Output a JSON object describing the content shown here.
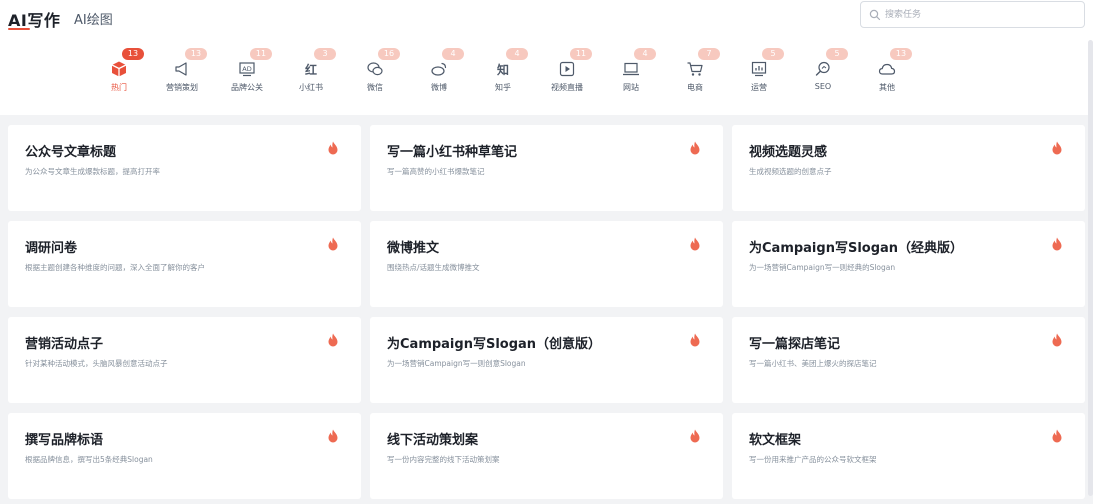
{
  "header": {
    "tabs": [
      {
        "label": "AI写作",
        "active": true
      },
      {
        "label": "AI绘图",
        "active": false
      }
    ],
    "search": {
      "placeholder": "搜索任务"
    }
  },
  "categories": [
    {
      "label": "热门",
      "count": "13",
      "icon": "cube-icon",
      "active": true
    },
    {
      "label": "营销策划",
      "count": "13",
      "icon": "megaphone-icon",
      "active": false
    },
    {
      "label": "品牌公关",
      "count": "11",
      "icon": "ad-icon",
      "active": false
    },
    {
      "label": "小红书",
      "count": "3",
      "icon": "xiaohongshu-icon",
      "active": false
    },
    {
      "label": "微信",
      "count": "16",
      "icon": "wechat-icon",
      "active": false
    },
    {
      "label": "微博",
      "count": "4",
      "icon": "weibo-icon",
      "active": false
    },
    {
      "label": "知乎",
      "count": "4",
      "icon": "zhihu-icon",
      "active": false
    },
    {
      "label": "视频直播",
      "count": "11",
      "icon": "video-play-icon",
      "active": false
    },
    {
      "label": "网站",
      "count": "4",
      "icon": "laptop-icon",
      "active": false
    },
    {
      "label": "电商",
      "count": "7",
      "icon": "cart-icon",
      "active": false
    },
    {
      "label": "运营",
      "count": "5",
      "icon": "chart-monitor-icon",
      "active": false
    },
    {
      "label": "SEO",
      "count": "5",
      "icon": "seo-search-icon",
      "active": false
    },
    {
      "label": "其他",
      "count": "13",
      "icon": "cloud-icon",
      "active": false
    }
  ],
  "cards": [
    {
      "title": "公众号文章标题",
      "desc": "为公众号文章生成爆款标题，提高打开率"
    },
    {
      "title": "写一篇小红书种草笔记",
      "desc": "写一篇高赞的小红书爆款笔记"
    },
    {
      "title": "视频选题灵感",
      "desc": "生成视频选题的创意点子"
    },
    {
      "title": "调研问卷",
      "desc": "根据主题创建各种维度的问题，深入全面了解你的客户"
    },
    {
      "title": "微博推文",
      "desc": "围绕热点/话题生成微博推文"
    },
    {
      "title": "为Campaign写Slogan（经典版）",
      "desc": "为一场营销Campaign写一则经典的Slogan"
    },
    {
      "title": "营销活动点子",
      "desc": "针对某种活动模式，头脑风暴创意活动点子"
    },
    {
      "title": "为Campaign写Slogan（创意版）",
      "desc": "为一场营销Campaign写一则创意Slogan"
    },
    {
      "title": "写一篇探店笔记",
      "desc": "写一篇小红书、美团上爆火的探店笔记"
    },
    {
      "title": "撰写品牌标语",
      "desc": "根据品牌信息，撰写出5条经典Slogan"
    },
    {
      "title": "线下活动策划案",
      "desc": "写一份内容完整的线下活动策划案"
    },
    {
      "title": "软文框架",
      "desc": "写一份用来推广产品的公众号软文框架"
    }
  ],
  "colors": {
    "accent": "#e8503a",
    "badge_inactive": "#f7c9bf",
    "background": "#f2f3f5"
  }
}
